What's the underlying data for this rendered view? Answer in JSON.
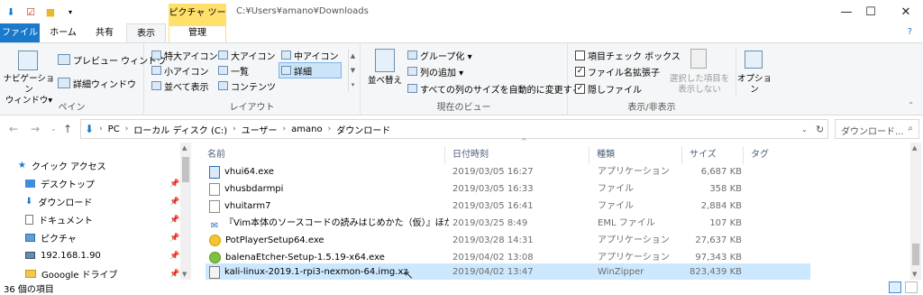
{
  "titlebar": {
    "context_group": "ピクチャ ツール",
    "path": "C:¥Users¥amano¥Downloads",
    "minimize": "—",
    "maximize": "☐",
    "close": "✕"
  },
  "tabs": {
    "file": "ファイル",
    "home": "ホーム",
    "share": "共有",
    "view": "表示",
    "manage": "管理",
    "help": "?"
  },
  "ribbon": {
    "pane": {
      "navigation_pane": "ナビゲーション\nウィンドウ▾",
      "preview_pane": "プレビュー ウィンドウ",
      "details_pane": "詳細ウィンドウ",
      "label": "ペイン"
    },
    "layout": {
      "items": [
        "特大アイコン",
        "大アイコン",
        "中アイコン",
        "小アイコン",
        "一覧",
        "詳細",
        "並べて表示",
        "コンテンツ"
      ],
      "label": "レイアウト"
    },
    "current_view": {
      "sort": "並べ替え",
      "group_by": "グループ化 ▾",
      "add_column": "列の追加 ▾",
      "size_all": "すべての列のサイズを自動的に変更する",
      "label": "現在のビュー"
    },
    "show_hide": {
      "item_checkboxes": "項目チェック ボックス",
      "extensions": "ファイル名拡張子",
      "hidden": "隠しファイル",
      "hide_selected": "選択した項目を\n表示しない",
      "options": "オプション",
      "label": "表示/非表示"
    }
  },
  "address": {
    "crumbs": [
      "PC",
      "ローカル ディスク (C:)",
      "ユーザー",
      "amano",
      "ダウンロード"
    ],
    "search_placeholder": "ダウンロード..."
  },
  "nav": {
    "items": [
      {
        "label": "クイック アクセス"
      },
      {
        "label": "デスクトップ"
      },
      {
        "label": "ダウンロード"
      },
      {
        "label": "ドキュメント"
      },
      {
        "label": "ピクチャ"
      },
      {
        "label": "192.168.1.90"
      },
      {
        "label": "Gooogle ドライブ"
      }
    ]
  },
  "columns": {
    "name": "名前",
    "date": "日付時刻",
    "type": "種類",
    "size": "サイズ",
    "tag": "タグ"
  },
  "files": [
    {
      "name": "vhui64.exe",
      "date": "2019/03/05 16:27",
      "type": "アプリケーション",
      "size": "6,687 KB"
    },
    {
      "name": "vhusbdarmpi",
      "date": "2019/03/05 16:33",
      "type": "ファイル",
      "size": "358 KB"
    },
    {
      "name": "vhuitarm7",
      "date": "2019/03/05 16:41",
      "type": "ファイル",
      "size": "2,884 KB"
    },
    {
      "name": "『Vim本体のソースコードの読みはじめかた（仮）』ほか.eml",
      "date": "2019/03/25 8:49",
      "type": "EML ファイル",
      "size": "107 KB"
    },
    {
      "name": "PotPlayerSetup64.exe",
      "date": "2019/03/28 14:31",
      "type": "アプリケーション",
      "size": "27,637 KB"
    },
    {
      "name": "balenaEtcher-Setup-1.5.19-x64.exe",
      "date": "2019/04/02 13:08",
      "type": "アプリケーション",
      "size": "97,343 KB"
    },
    {
      "name": "kali-linux-2019.1-rpi3-nexmon-64.img.xz",
      "date": "2019/04/02 13:47",
      "type": "WinZipper",
      "size": "823,439 KB"
    }
  ],
  "status": {
    "count": "36 個の項目"
  }
}
